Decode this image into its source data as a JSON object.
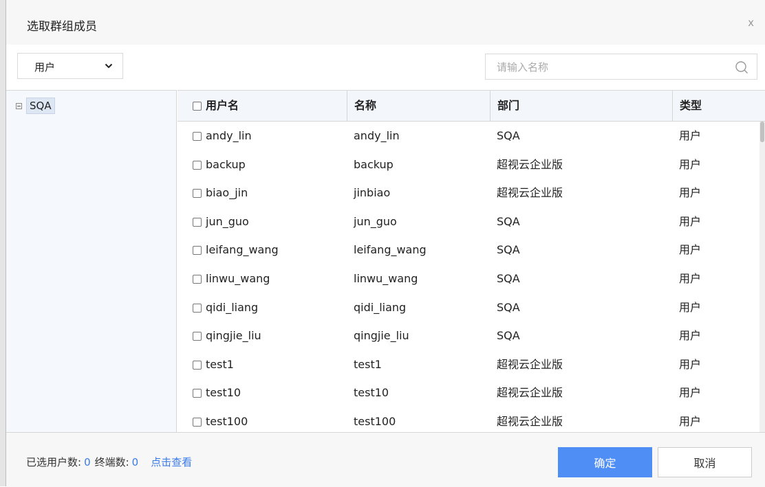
{
  "dialog": {
    "title": "选取群组成员",
    "close_label": "x"
  },
  "toolbar": {
    "type_select_value": "用户",
    "search_placeholder": "请输入名称",
    "icons": {
      "select": "chevron-down-icon",
      "search": "search-icon"
    }
  },
  "tree": {
    "root_label": "SQA",
    "root_expanded": true
  },
  "table": {
    "columns": [
      "用户名",
      "名称",
      "部门",
      "类型"
    ],
    "rows": [
      {
        "username": "andy_lin",
        "name": "andy_lin",
        "dept": "SQA",
        "type": "用户"
      },
      {
        "username": "backup",
        "name": "backup",
        "dept": "超视云企业版",
        "type": "用户"
      },
      {
        "username": "biao_jin",
        "name": "jinbiao",
        "dept": "超视云企业版",
        "type": "用户"
      },
      {
        "username": "jun_guo",
        "name": "jun_guo",
        "dept": "SQA",
        "type": "用户"
      },
      {
        "username": "leifang_wang",
        "name": "leifang_wang",
        "dept": "SQA",
        "type": "用户"
      },
      {
        "username": "linwu_wang",
        "name": "linwu_wang",
        "dept": "SQA",
        "type": "用户"
      },
      {
        "username": "qidi_liang",
        "name": "qidi_liang",
        "dept": "SQA",
        "type": "用户"
      },
      {
        "username": "qingjie_liu",
        "name": "qingjie_liu",
        "dept": "SQA",
        "type": "用户"
      },
      {
        "username": "test1",
        "name": "test1",
        "dept": "超视云企业版",
        "type": "用户"
      },
      {
        "username": "test10",
        "name": "test10",
        "dept": "超视云企业版",
        "type": "用户"
      },
      {
        "username": "test100",
        "name": "test100",
        "dept": "超视云企业版",
        "type": "用户"
      }
    ]
  },
  "footer": {
    "selected_users_label": "已选用户数:",
    "selected_users_count": "0",
    "terminals_label": "终端数:",
    "terminals_count": "0",
    "view_link": "点击查看",
    "ok_label": "确定",
    "cancel_label": "取消"
  },
  "colors": {
    "accent": "#4f8ef5",
    "link": "#3a7be8",
    "header_bg": "#f3f6fb",
    "tree_bg": "#f5f8fc"
  }
}
